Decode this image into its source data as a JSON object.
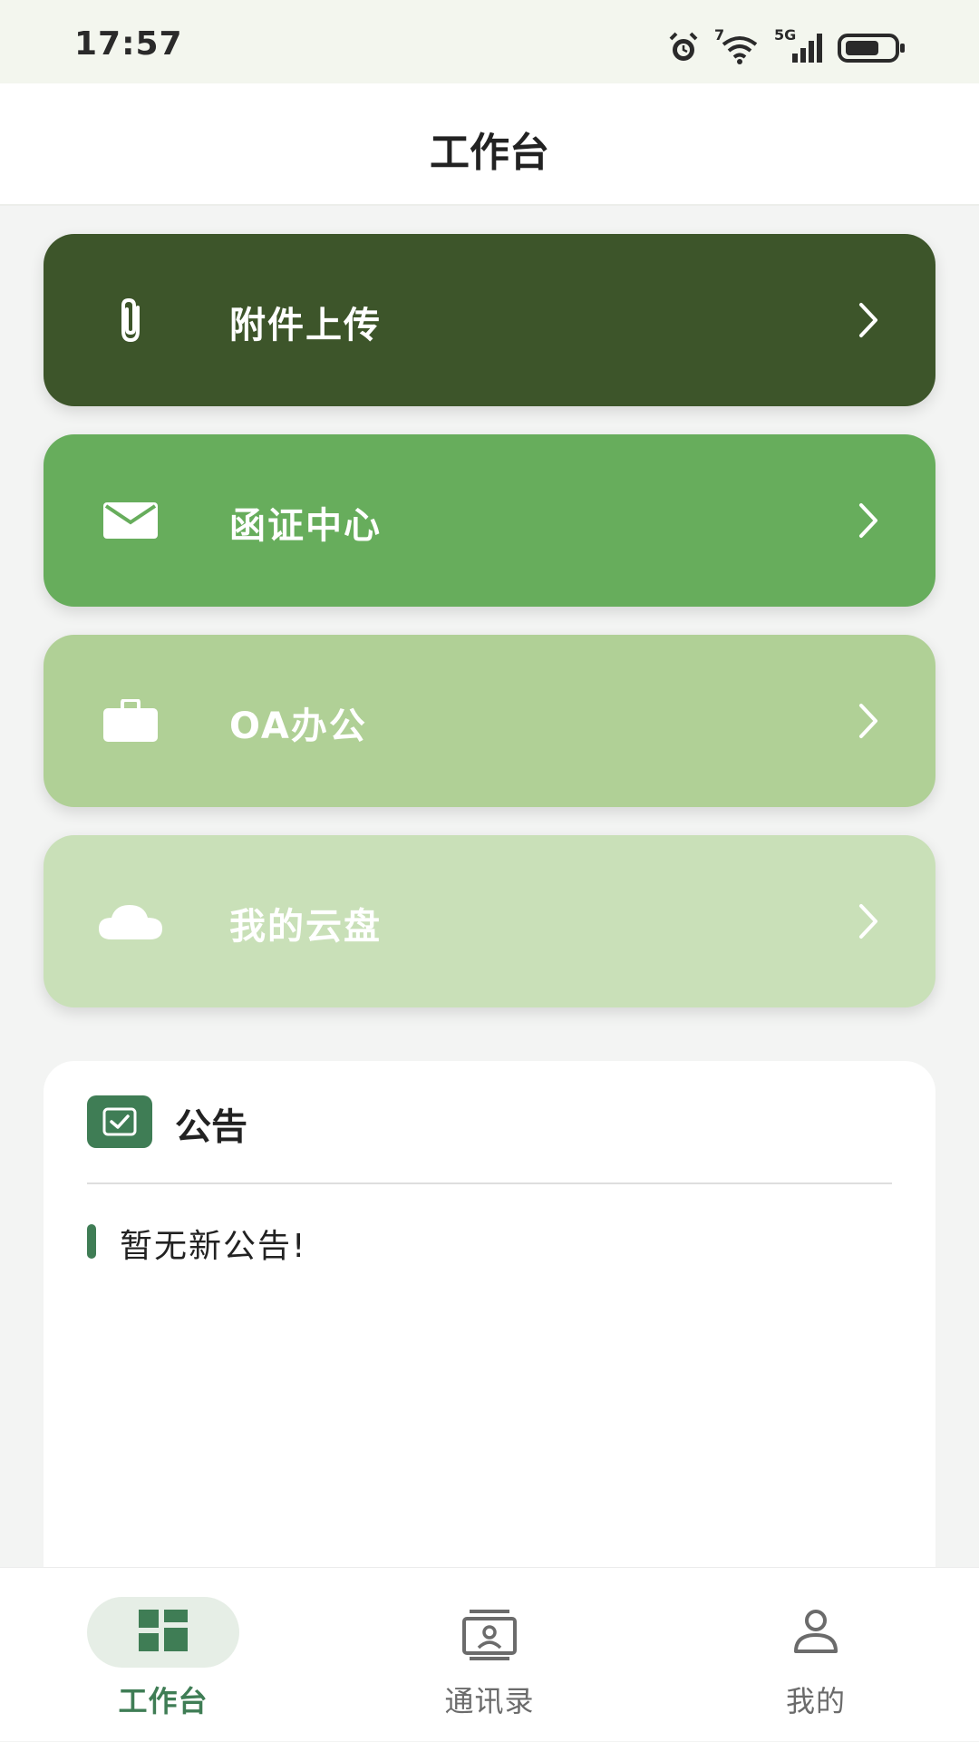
{
  "status_bar": {
    "time": "17:57",
    "wifi_superscript": "7",
    "network_label": "5G",
    "icons": [
      "alarm-icon",
      "wifi-icon",
      "signal-icon",
      "battery-icon"
    ]
  },
  "header": {
    "title": "工作台"
  },
  "menu": [
    {
      "label": "附件上传",
      "icon": "paperclip-icon",
      "color": "#3d552a"
    },
    {
      "label": "函证中心",
      "icon": "mail-icon",
      "color": "#67ad5c"
    },
    {
      "label": "OA办公",
      "icon": "briefcase-icon",
      "color": "#b0d096"
    },
    {
      "label": "我的云盘",
      "icon": "cloud-icon",
      "color": "#c9e0b8"
    }
  ],
  "notice": {
    "title": "公告",
    "icon": "checkbox-icon",
    "empty_text": "暂无新公告!"
  },
  "bottom_nav": {
    "items": [
      {
        "label": "工作台",
        "icon": "dashboard-icon",
        "active": true
      },
      {
        "label": "通讯录",
        "icon": "contacts-icon",
        "active": false
      },
      {
        "label": "我的",
        "icon": "person-icon",
        "active": false
      }
    ]
  },
  "colors": {
    "accent": "#3f7d55",
    "status_bar_bg": "#f3f6ee",
    "page_bg": "#f3f4f3"
  }
}
